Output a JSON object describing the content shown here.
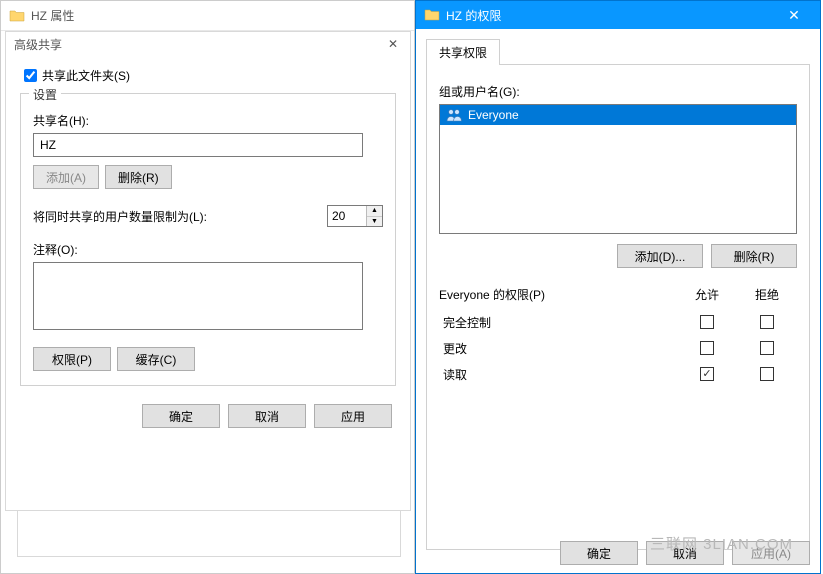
{
  "left_window": {
    "title": "HZ 属性"
  },
  "adv_share": {
    "title": "高级共享",
    "share_checkbox_label": "共享此文件夹(S)",
    "share_checked": true,
    "settings_legend": "设置",
    "share_name_label": "共享名(H):",
    "share_name_value": "HZ",
    "add_btn": "添加(A)",
    "remove_btn": "删除(R)",
    "limit_label": "将同时共享的用户数量限制为(L):",
    "limit_value": "20",
    "comment_label": "注释(O):",
    "comment_value": "",
    "perm_btn": "权限(P)",
    "cache_btn": "缓存(C)",
    "ok_btn": "确定",
    "cancel_btn": "取消",
    "apply_btn": "应用"
  },
  "right_window": {
    "title": "HZ 的权限",
    "tab_label": "共享权限",
    "group_label": "组或用户名(G):",
    "list_items": [
      {
        "name": "Everyone"
      }
    ],
    "add_btn": "添加(D)...",
    "remove_btn": "删除(R)",
    "perm_for_label": "Everyone 的权限(P)",
    "col_allow": "允许",
    "col_deny": "拒绝",
    "rows": [
      {
        "name": "完全控制",
        "allow": false,
        "deny": false
      },
      {
        "name": "更改",
        "allow": false,
        "deny": false
      },
      {
        "name": "读取",
        "allow": true,
        "deny": false
      }
    ],
    "ok_btn": "确定",
    "cancel_btn": "取消",
    "apply_btn": "应用(A)"
  },
  "watermark": "三联网 3LIAN.COM"
}
